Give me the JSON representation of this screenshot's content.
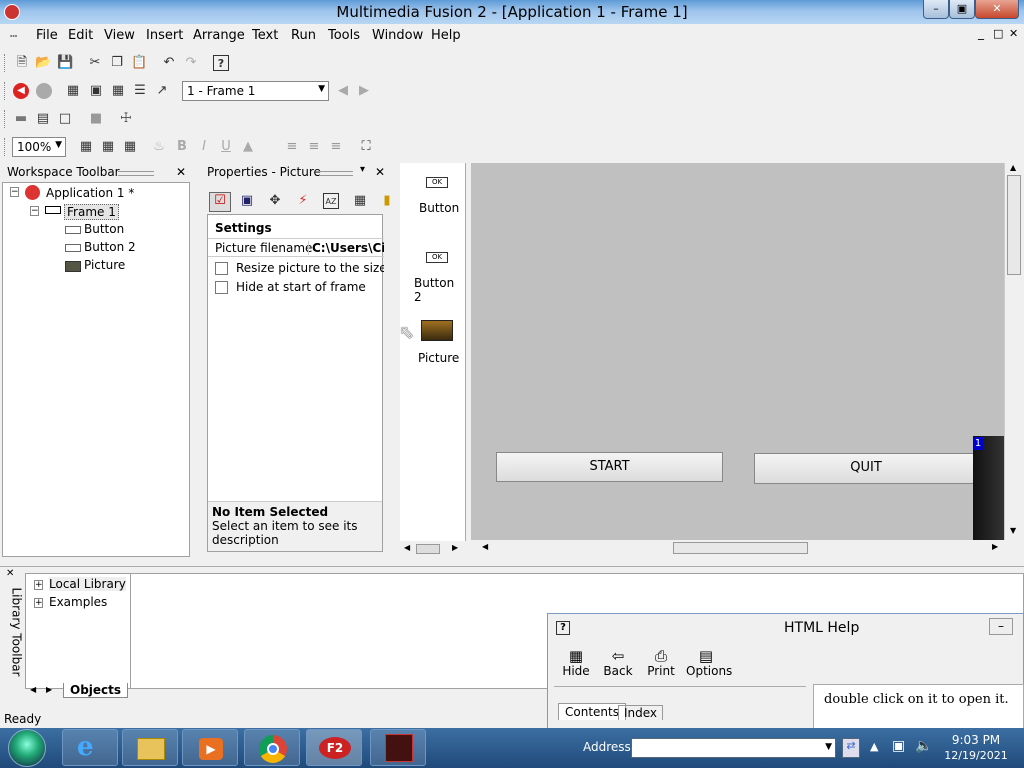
{
  "window": {
    "title": "Multimedia Fusion 2 - [Application 1 - Frame 1]",
    "min": "–",
    "max": "▣",
    "close": "✕",
    "mdi_min": "_",
    "mdi_restore": "□",
    "mdi_close": "✕"
  },
  "menu": [
    "File",
    "Edit",
    "View",
    "Insert",
    "Arrange",
    "Text",
    "Run",
    "Tools",
    "Window",
    "Help"
  ],
  "toolbar": {
    "frame_select": "1 - Frame 1",
    "zoom": "100%"
  },
  "workspace": {
    "title": "Workspace Toolbar",
    "app": "Application 1 *",
    "frame": "Frame 1",
    "objects": [
      "Button",
      "Button 2",
      "Picture"
    ]
  },
  "properties": {
    "title": "Properties - Picture",
    "section": "Settings",
    "filename_label": "Picture filename",
    "filename_value": "C:\\Users\\Ci",
    "resize_label": "Resize picture to the size o",
    "hide_label": "Hide at start of frame",
    "desc_title": "No Item Selected",
    "desc_text": "Select an item to see its description"
  },
  "object_strip": {
    "button_icon": "OK",
    "button2_icon": "OK",
    "items": [
      "Button",
      "Button 2",
      "Picture"
    ]
  },
  "frame": {
    "start": "START",
    "quit": "QUIT",
    "layer_badge": "1"
  },
  "library": {
    "title": "Library Toolbar",
    "items": [
      "Local Library",
      "Examples"
    ],
    "tab": "Objects"
  },
  "status": {
    "text": "Ready"
  },
  "help": {
    "title": "HTML Help",
    "buttons": [
      "Hide",
      "Back",
      "Print",
      "Options"
    ],
    "tabs": [
      "Contents",
      "Index"
    ],
    "body": "double click on it to open it."
  },
  "taskbar": {
    "address_label": "Address",
    "app_label": "F2",
    "time": "9:03 PM",
    "date": "12/19/2021"
  },
  "colors": {
    "frame_bg": "#c0c0c0",
    "taskbar": "#1f4a7a",
    "layer_badge": "#0000cc"
  }
}
